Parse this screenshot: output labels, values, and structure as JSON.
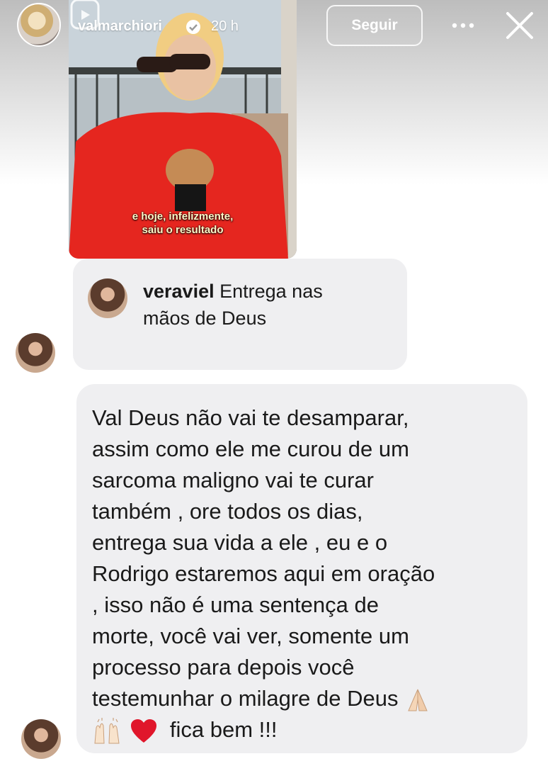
{
  "header": {
    "username": "valmarchiori",
    "timestamp": "20 h",
    "follow_label": "Seguir"
  },
  "video": {
    "subtitle_line1": "e hoje, infelizmente,",
    "subtitle_line2": "saiu o resultado"
  },
  "reply": {
    "username": "veraviel",
    "text_line1": "Entrega nas",
    "text_line2": "mãos de Deus"
  },
  "message": {
    "lines": [
      "Val Deus não vai te desamparar,",
      "assim como ele me curou de um",
      "sarcoma maligno vai te curar",
      "também , ore todos os dias,",
      "entrega sua vida a ele , eu e o",
      "Rodrigo estaremos aqui em oração",
      ", isso não é uma sentença de",
      "morte, você vai ver, somente um",
      "processo para depois você",
      "testemunhar o milagre de Deus",
      "fica bem !!!"
    ],
    "emojis": [
      "folded-hands",
      "raising-hands",
      "red-heart"
    ]
  },
  "colors": {
    "bubble": "#efeff1",
    "text": "#1a1a1a",
    "verified": "#ffffff"
  }
}
